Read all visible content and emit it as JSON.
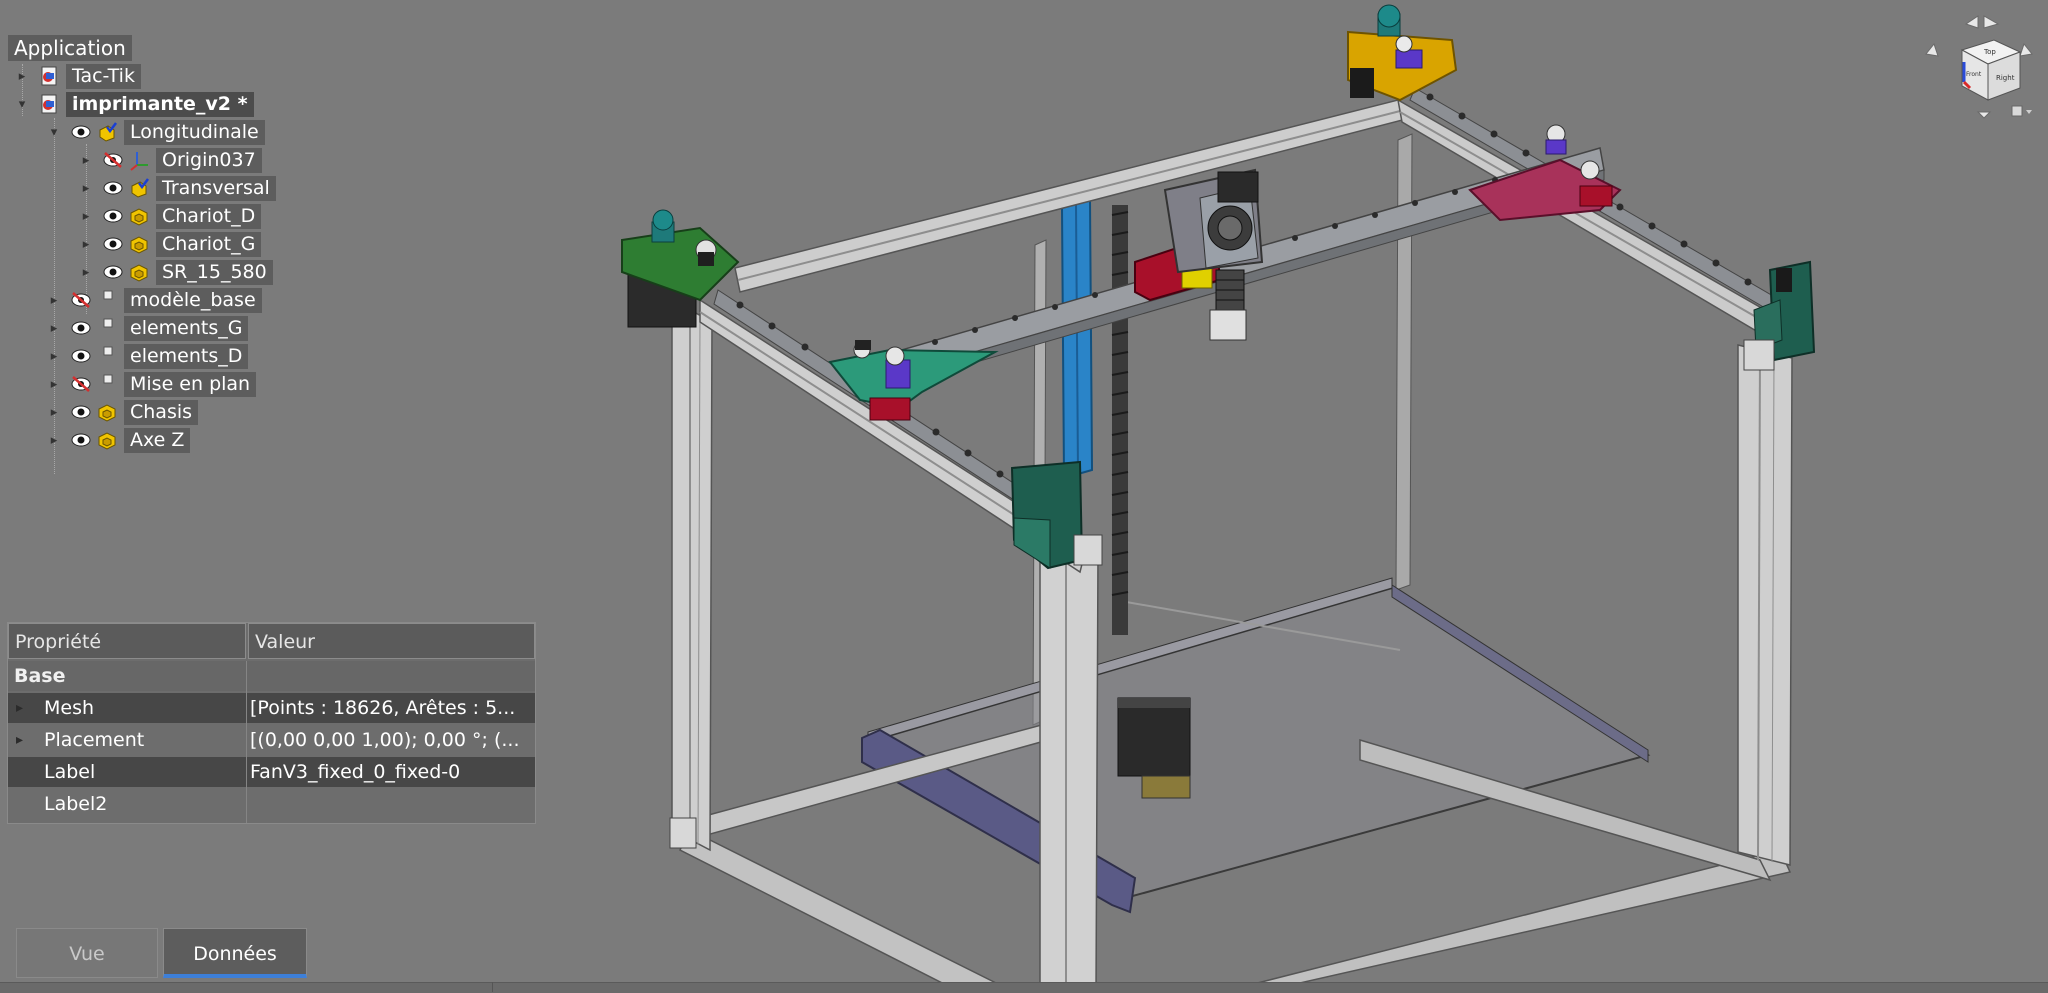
{
  "tree": {
    "root_label": "Application",
    "items": [
      {
        "label": "Tac-Tik",
        "icon": "document-icon",
        "visible": null,
        "bold": false
      },
      {
        "label": "imprimante_v2 *",
        "icon": "document-icon",
        "visible": null,
        "bold": true
      },
      {
        "label": "Longitudinale",
        "icon": "assembly-checked-icon",
        "visible": true,
        "bold": false
      },
      {
        "label": "Origin037",
        "icon": "origin-axes-icon",
        "visible": false,
        "bold": false
      },
      {
        "label": "Transversal",
        "icon": "assembly-checked-icon",
        "visible": true,
        "bold": false
      },
      {
        "label": "Chariot_D",
        "icon": "part-icon",
        "visible": true,
        "bold": false
      },
      {
        "label": "Chariot_G",
        "icon": "part-icon",
        "visible": true,
        "bold": false
      },
      {
        "label": "SR_15_580",
        "icon": "part-icon",
        "visible": true,
        "bold": false
      },
      {
        "label": "modèle_base",
        "icon": "group-icon",
        "visible": false,
        "bold": false
      },
      {
        "label": "elements_G",
        "icon": "group-icon",
        "visible": true,
        "bold": false
      },
      {
        "label": "elements_D",
        "icon": "group-icon",
        "visible": true,
        "bold": false
      },
      {
        "label": "Mise en plan",
        "icon": "group-icon",
        "visible": false,
        "bold": false
      },
      {
        "label": "Chasis",
        "icon": "part-icon",
        "visible": true,
        "bold": false
      },
      {
        "label": "Axe Z",
        "icon": "part-icon",
        "visible": true,
        "bold": false
      }
    ]
  },
  "properties": {
    "header_property": "Propriété",
    "header_value": "Valeur",
    "group": "Base",
    "rows": [
      {
        "name": "Mesh",
        "value": "[Points : 18626, Arêtes : 5..."
      },
      {
        "name": "Placement",
        "value": "[(0,00 0,00 1,00); 0,00 °; (..."
      },
      {
        "name": "Label",
        "value": "FanV3_fixed_0_fixed-0"
      },
      {
        "name": "Label2",
        "value": ""
      }
    ]
  },
  "tabs": {
    "vue": "Vue",
    "donnees": "Données"
  },
  "navcube": {
    "face_top": "Top",
    "face_front": "Front",
    "face_right": "Right"
  },
  "colors": {
    "background": "#7b7b7b",
    "extrusion": "#c9c9c9",
    "rail": "#8c8f94",
    "bracket_green": "#2e7d32",
    "bracket_teal": "#1e5e4f",
    "bracket_orange": "#d9a400",
    "rod_blue": "#2a84c8",
    "plate_violet": "#5a5a86",
    "carriage_red": "#a8102a",
    "selection_blue": "#3d7fd8"
  }
}
